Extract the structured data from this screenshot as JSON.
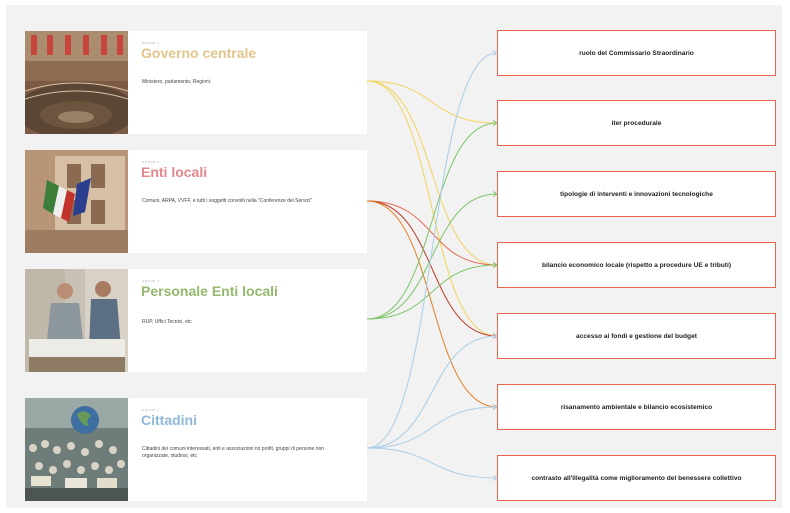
{
  "groups": [
    {
      "tag": "GROUP 1",
      "title": "Governo centrale",
      "desc": "Ministero, parlamento, Regioni.",
      "color": "#e2c48a",
      "photo": "parliament-photo"
    },
    {
      "tag": "GROUP 2",
      "title": "Enti locali",
      "desc": "Comuni, ARPA, VVFF, e tutti i soggetti convolti nella \"Conferenze dei Servizi\"",
      "color": "#e3878c",
      "photo": "town-hall-flags-photo"
    },
    {
      "tag": "GROUP 3",
      "title": "Personale Enti locali",
      "desc": "RUP, Uffici Tecnici, etc",
      "color": "#93b96d",
      "photo": "technicians-photo"
    },
    {
      "tag": "GROUP 4",
      "title": "Cittadini",
      "desc": "Cittadini dei comuni interessati, enti e associazioni no profit, gruppi di persone non organizzate, studiosi, etc",
      "color": "#8fb8d8",
      "photo": "crowd-protest-photo"
    }
  ],
  "topics": [
    "ruolo del Commissario Straordinario",
    "iter procedurale",
    "tipologie di interventi e innovazioni tecnologiche",
    "bilancio economico locale (rispetto a procedure UE e tributi)",
    "accesso ai fondi e gestione del budget",
    "risanamento ambientale e bilancio ecosistemico",
    "contrasto all'illegalità come miglioramento del benessere collettivo"
  ],
  "links": [
    {
      "from": 0,
      "to": 1,
      "color": "#f2d35a"
    },
    {
      "from": 0,
      "to": 3,
      "color": "#f2d35a"
    },
    {
      "from": 0,
      "to": 4,
      "color": "#f2d35a"
    },
    {
      "from": 1,
      "to": 3,
      "color": "#e8654c"
    },
    {
      "from": 1,
      "to": 4,
      "color": "#c0392b"
    },
    {
      "from": 1,
      "to": 5,
      "color": "#e67e22"
    },
    {
      "from": 2,
      "to": 1,
      "color": "#7cc46a"
    },
    {
      "from": 2,
      "to": 2,
      "color": "#7cc46a"
    },
    {
      "from": 2,
      "to": 3,
      "color": "#7cc46a"
    },
    {
      "from": 3,
      "to": 0,
      "color": "#a9cde5"
    },
    {
      "from": 3,
      "to": 4,
      "color": "#a9cde5"
    },
    {
      "from": 3,
      "to": 5,
      "color": "#a9cde5"
    },
    {
      "from": 3,
      "to": 6,
      "color": "#a9cde5"
    }
  ]
}
